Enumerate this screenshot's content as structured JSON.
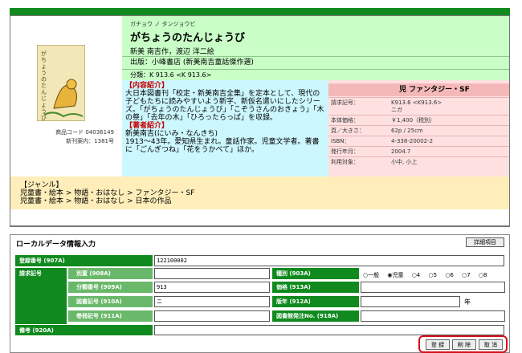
{
  "book": {
    "kana": "ガチョウ ノ タンジョウビ",
    "title": "がちょうのたんじょうび",
    "authors": "新美 南吉作，渡辺 洋二絵",
    "publisher": "出版：小峰書店 (新美南吉童話傑作選)",
    "classification": "分類：K 913.6 <K 913.6>",
    "cover_title": "がちょうのたんじょうび",
    "product_code": "商品コード 04036149",
    "new_guide": "新刊案内：1381号"
  },
  "description": {
    "content_heading": "【内容紹介】",
    "content_text": "大日本図書刊「校定・新美南吉全集」を定本として、現代の子どもたちに読みやすいよう新字、新仮名遣いにしたシリーズ。「がちょうのたんじょうび」「こぞうさんのおきょう」「木の祭」「去年の木」「ひろったらっぱ」を収録。",
    "author_heading": "【著者紹介】",
    "author_text": "新美南吉(にいみ・なんきち)\n1913〜43年。愛知県生まれ。童話作家。児童文学者。著書に「ごんぎつね」「花をうかべて」ほか。"
  },
  "details": {
    "genre_label": "児 ファンタジー・SF",
    "rows": [
      {
        "key": "請求記号：",
        "value": "K913.6 <K913.6>"
      },
      {
        "key": "",
        "value": "ニガ"
      },
      {
        "key": "本体価格：",
        "value": "￥1,400（税別）"
      },
      {
        "key": "頁／大きさ：",
        "value": "62p / 25cm"
      },
      {
        "key": "ISBN：",
        "value": "4-338-20002-2"
      },
      {
        "key": "発行年月：",
        "value": "2004.7"
      },
      {
        "key": "利用対象：",
        "value": "小中, 小上"
      }
    ]
  },
  "genre": {
    "heading": "【ジャンル】",
    "line1": "児童書・絵本 > 物語・おはなし > ファンタジー・SF",
    "line2": "児童書・絵本 > 物語・おはなし > 日本の作品"
  },
  "local_form": {
    "title": "ローカルデータ情報入力",
    "detail_button": "詳細項目",
    "reg_number_label": "登録番号 (907A)",
    "reg_number_value": "122100002",
    "call_number_label": "請求記号",
    "separate_label": "別置 (908A)",
    "separate_value": "",
    "class_label": "分類番号 (909A)",
    "class_value": "913",
    "book_mark_label": "図書記号 (910A)",
    "book_mark_value": "ニ",
    "volume_label": "巻冊記号 (911A)",
    "volume_value": "",
    "type_label": "種別 (903A)",
    "type_options": [
      "一般",
      "児童",
      "4",
      "5",
      "6",
      "7",
      "8"
    ],
    "type_selected": "児童",
    "price_label": "価格 (913A)",
    "price_value": "",
    "edition_label": "版年 (912A)",
    "edition_value": "",
    "year_suffix": "年",
    "library_no_label": "図書館発注No. (918A)",
    "library_no_value": "",
    "remarks_label": "備考 (920A)",
    "remarks_value": "",
    "btn_register": "登 録",
    "btn_delete": "削 除",
    "btn_cancel": "取 消"
  }
}
